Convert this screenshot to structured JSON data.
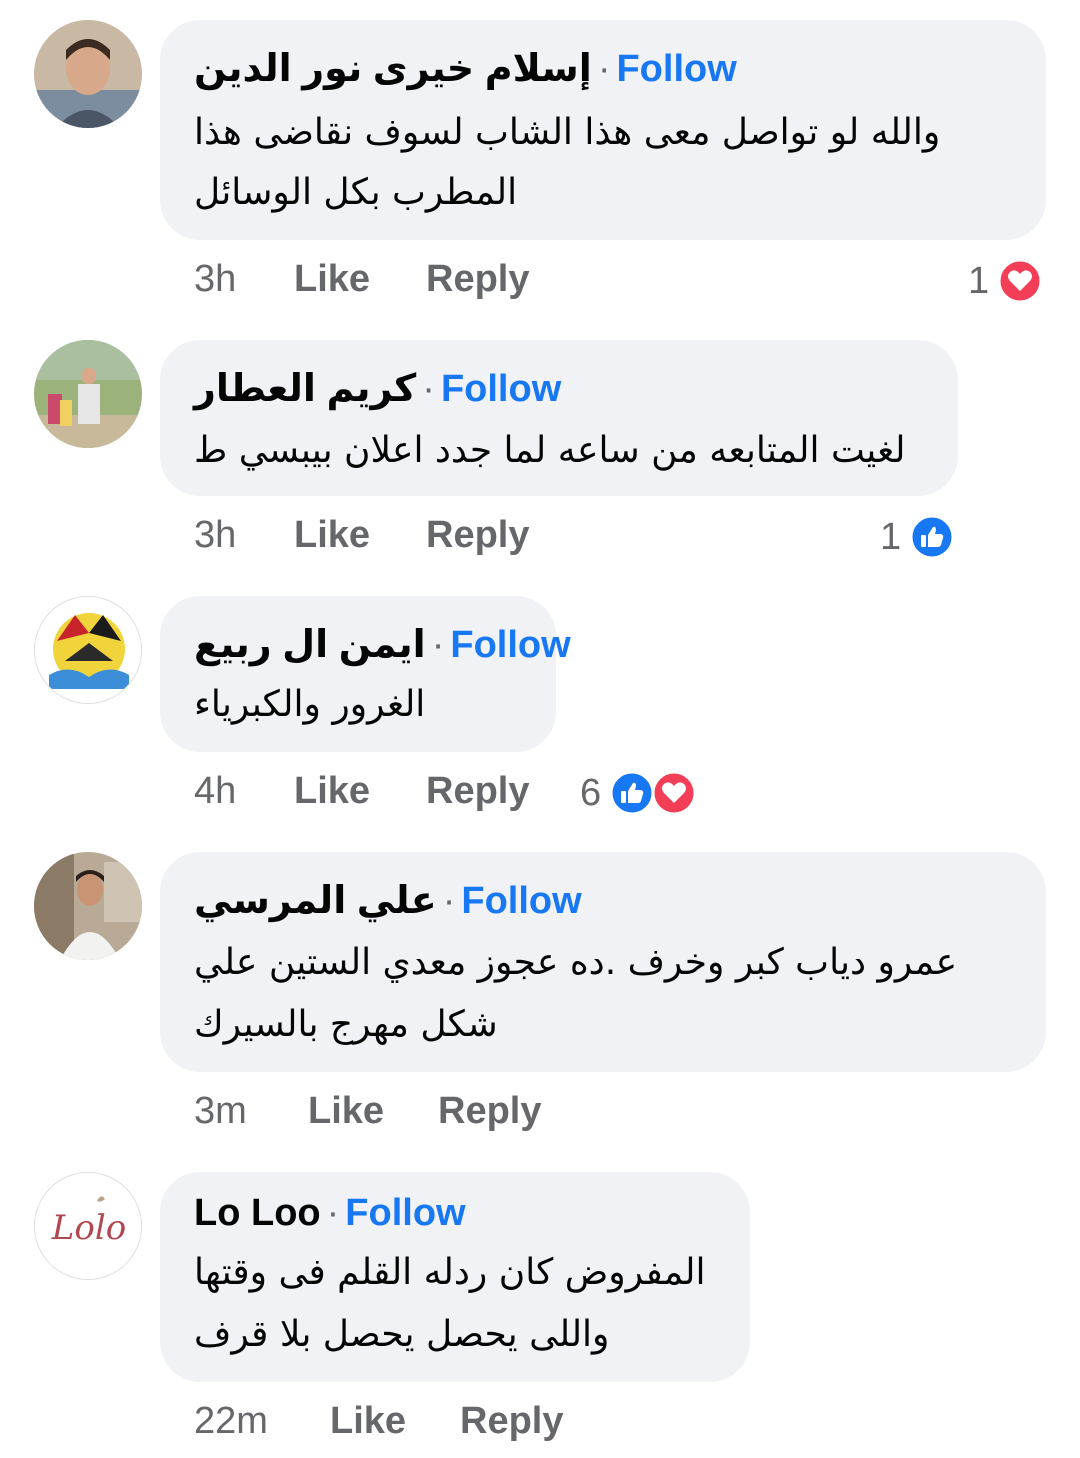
{
  "follow_label": "Follow",
  "like_label": "Like",
  "reply_label": "Reply",
  "comments": [
    {
      "author": "إسلام خيرى نور الدين",
      "text_lines": [
        "والله لو تواصل معى هذا الشاب لسوف نقاضى هذا",
        "المطرب بكل الوسائل"
      ],
      "time": "3h",
      "reaction_count": "1",
      "reactions": [
        "heart-icon"
      ]
    },
    {
      "author": "كريم العطار",
      "text_lines": [
        "لغيت المتابعه من ساعه لما جدد اعلان بيبسي ط"
      ],
      "time": "3h",
      "reaction_count": "1",
      "reactions": [
        "like-icon"
      ]
    },
    {
      "author": "ايمن ال ربيع",
      "text_lines": [
        "الغرور والكبرياء"
      ],
      "time": "4h",
      "reaction_count": "6",
      "reactions": [
        "like-icon",
        "heart-icon"
      ]
    },
    {
      "author": "علي المرسي",
      "text_lines": [
        "عمرو دياب كبر وخرف .ده عجوز معدي الستين علي",
        "شكل مهرج بالسيرك"
      ],
      "time": "3m",
      "reaction_count": "",
      "reactions": []
    },
    {
      "author": "Lo Loo",
      "text_lines": [
        "المفروض كان ردله القلم فى وقتها",
        "واللى يحصل يحصل بلا قرف"
      ],
      "time": "22m",
      "reaction_count": "",
      "reactions": []
    }
  ],
  "avatar_logo_text": "Lolo",
  "colors": {
    "bubble": "#f0f2f5",
    "follow": "#1877f2",
    "meta": "#65676b",
    "like": "#1877f2",
    "heart": "#f33e58"
  }
}
